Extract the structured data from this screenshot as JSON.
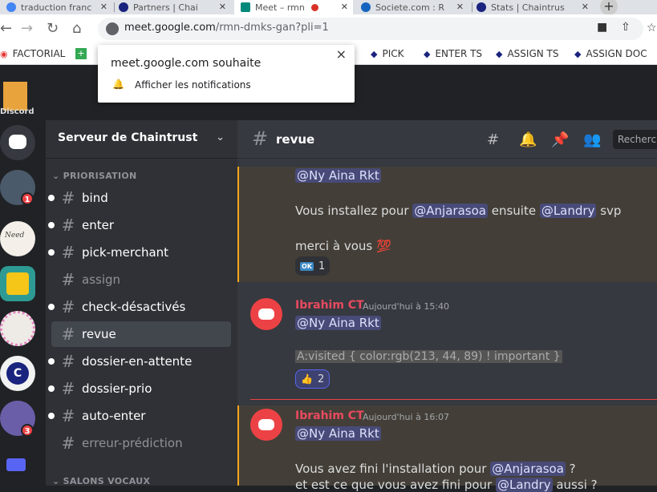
{
  "browser": {
    "tabs": [
      {
        "label": "traduction franc",
        "icon_color": "#4285f4"
      },
      {
        "label": "Partners | Chai",
        "icon_color": "#1a237e"
      },
      {
        "label": "Meet – rmn",
        "icon_color": "#00897b"
      },
      {
        "label": "Societe.com : R",
        "icon_color": "#1565c0"
      },
      {
        "label": "Stats | Chaintrus",
        "icon_color": "#1a237e"
      }
    ],
    "new_tab_label": "+",
    "url_host": "meet.google.com",
    "url_path": "/rmn-dmks-gan?pli=1",
    "bookmarks": [
      {
        "label": "FACTORIAL",
        "icon": "red-circle-icon"
      },
      {
        "label": "PICK",
        "icon": "diamond-icon"
      },
      {
        "label": "ENTER TS",
        "icon": "diamond-icon"
      },
      {
        "label": "ASSIGN TS",
        "icon": "diamond-icon"
      },
      {
        "label": "ASSIGN DOC",
        "icon": "diamond-icon"
      }
    ]
  },
  "notification": {
    "title": "meet.google.com souhaite",
    "message": "Afficher les notifications",
    "close": "×"
  },
  "discord": {
    "logo_text": "Discord",
    "badges": [
      "1",
      "3"
    ],
    "server_name": "Serveur de Chaintrust",
    "category": "PRIORISATION",
    "channels": [
      {
        "name": "bind",
        "unread": true
      },
      {
        "name": "enter",
        "unread": true
      },
      {
        "name": "pick-merchant",
        "unread": true
      },
      {
        "name": "assign",
        "unread": false
      },
      {
        "name": "check-désactivés",
        "unread": true
      },
      {
        "name": "revue",
        "unread": false,
        "selected": true
      },
      {
        "name": "dossier-en-attente",
        "unread": true
      },
      {
        "name": "dossier-prio",
        "unread": true
      },
      {
        "name": "auto-enter",
        "unread": true
      },
      {
        "name": "erreur-prédiction",
        "unread": false
      }
    ],
    "category2": "SALONS VOCAUX",
    "channel_title": "revue",
    "search_placeholder": "Recherc",
    "messages": {
      "m0": {
        "mention": "@Ny Aina Rkt",
        "line1_a": "Vous installez pour ",
        "line1_mention1": "@Anjarasoa",
        "line1_b": " ensuite ",
        "line1_mention2": "@Landry",
        "line1_c": " svp",
        "line2": "merci à vous",
        "line2_emoji": "💯",
        "reaction_emoji": "OK",
        "reaction_count": "1"
      },
      "m1": {
        "author": "Ibrahim CT",
        "time": "Aujourd'hui à 15:40",
        "mention": "@Ny Aina Rkt",
        "code": "A:visited { color:rgb(213, 44, 89) ! important }",
        "reaction_emoji": "👍",
        "reaction_count": "2"
      },
      "m2": {
        "author": "Ibrahim CT",
        "time": "Aujourd'hui à 16:07",
        "mention": "@Ny Aina Rkt",
        "line1_a": "Vous avez fini l'installation pour ",
        "line1_mention": "@Anjarasoa",
        "line1_b": " ?",
        "line2_a": "et est ce que vous avez fini pour ",
        "line2_mention": "@Landry",
        "line2_b": " aussi ?"
      }
    }
  }
}
